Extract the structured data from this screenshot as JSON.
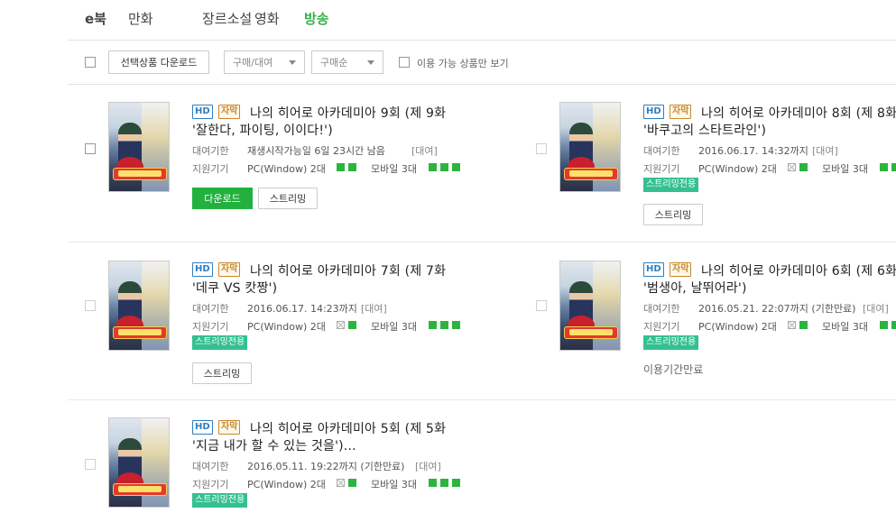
{
  "tabs": [
    "e북",
    "만화",
    "장르소설",
    "영화",
    "방송"
  ],
  "toolbar": {
    "download_selected": "선택상품 다운로드",
    "filter_type": "구매/대여",
    "sort": "구매순",
    "available_only": "이용 가능 상품만 보기"
  },
  "labels": {
    "hd": "HD",
    "sub": "자막",
    "rent_period": "대여기한",
    "devices": "지원기기",
    "pc": "PC(Window) 2대",
    "mobile": "모바일 3대",
    "rent_tag": "[대여]",
    "streaming_only": "스트리밍전용",
    "download": "다운로드",
    "streaming": "스트리밍",
    "expired": "이용기간만료"
  },
  "items": [
    {
      "title1": "나의 히어로 아카데미아 9회 (제 9화",
      "title2": "'잘한다, 파이팅, 이이다!')",
      "period": "재생시작가능일 6일 23시간 남음",
      "pc_ok": true
    },
    {
      "title1": "나의 히어로 아카데미아 8회 (제 8화",
      "title2": "'바쿠고의 스타트라인')",
      "period": "2016.06.17. 14:32까지",
      "pc_ok": false
    },
    {
      "title1": "나의 히어로 아카데미아 7회 (제 7화",
      "title2": "'데쿠 VS 캇짱')",
      "period": "2016.06.17. 14:23까지",
      "pc_ok": false
    },
    {
      "title1": "나의 히어로 아카데미아 6회 (제 6화",
      "title2": "'범생아, 날뛰어라')",
      "period": "2016.05.21. 22:07까지 (기한만료)",
      "pc_ok": false
    },
    {
      "title1": "나의 히어로 아카데미아 5회 (제 5화",
      "title2": "'지금 내가 할 수 있는 것을')...",
      "period": "2016.05.11. 19:22까지 (기한만료)",
      "pc_ok": false
    }
  ]
}
